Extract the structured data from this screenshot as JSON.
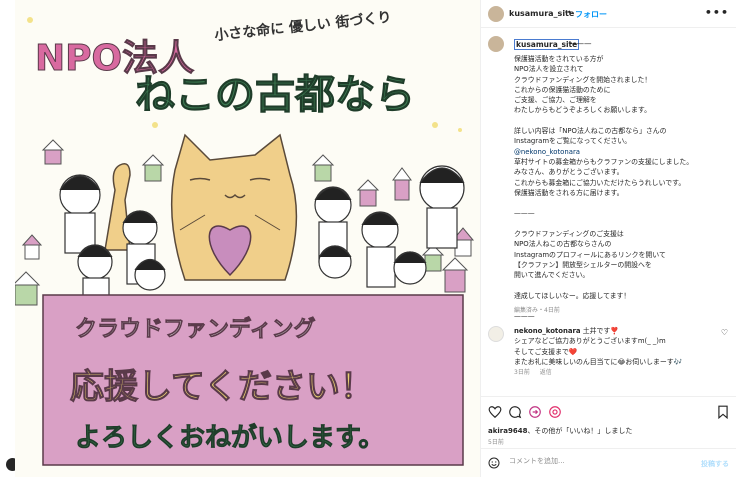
{
  "post_image": {
    "title_line1": "NPO法人",
    "slogan": "小さな命に 優しい 街づくり",
    "title_line2": "ねこの古都なら",
    "banner_line1": "クラウドファンディング",
    "banner_line2": "応援してください！",
    "banner_line3": "よろしくおねがいします。",
    "colors": {
      "banner": "#d9a0c5",
      "title_pink": "#d86aa0",
      "title_green": "#3d7a52",
      "cat": "#f0cf8a",
      "heart": "#c88dbd"
    }
  },
  "header": {
    "username": "kusamura_site",
    "separator": "•",
    "follow_label": "フォロー",
    "more_icon": "more-horizontal-icon"
  },
  "caption": {
    "username": "kusamura_site",
    "dash": "———",
    "text_part1": "保護猫活動をされている方が\nNPO法人を設立されて\nクラウドファンディングを開始されました！\nこれからの保護猫活動のために\nご支援、ご協力、ご理解を\nわたしからもどうぞよろしくお願いします。\n\n詳しい内容は「NPO法人ねこの古都なら」さんの\nInstagramをご覧になってください。",
    "mention": "@nekono_kotonara",
    "text_part2": "\n草村サイトの募金箱からもクラファンの支援にしました。\nみなさん、ありがとうございます。\nこれからも募金箱にご協力いただけたらうれしいです。\n保護猫活動をされる方に届けます。\n\n———\n\nクラウドファンディングのご支援は\nNPO法人ねこの古都ならさんの\nInstagramのプロフィールにあるリンクを開いて\n【クラファン】開放型シェルターの開設へを\n開いて進んでください。\n\n達成してほしいなー。応援してます！\n\n———",
    "meta": "編集済み・4日前"
  },
  "comment": {
    "username": "nekono_kotonara",
    "text": "土井です❣️\nシェアなどご協力ありがとうございますm(_ _)m\nそしてご支援まで❤️\nまたお礼に美味しいのん目当てに😂お伺いしまーす🎶",
    "time": "3日前",
    "reply_label": "返信"
  },
  "actions": {
    "like_icon": "heart-icon",
    "comment_icon": "comment-icon",
    "share_icon": "share-icon",
    "save_icon": "bookmark-icon"
  },
  "likes": {
    "user": "akira9648",
    "suffix": "、その他が「いいね！」しました"
  },
  "date": "5日前",
  "add_comment": {
    "placeholder": "コメントを追加...",
    "post_label": "投稿する"
  }
}
